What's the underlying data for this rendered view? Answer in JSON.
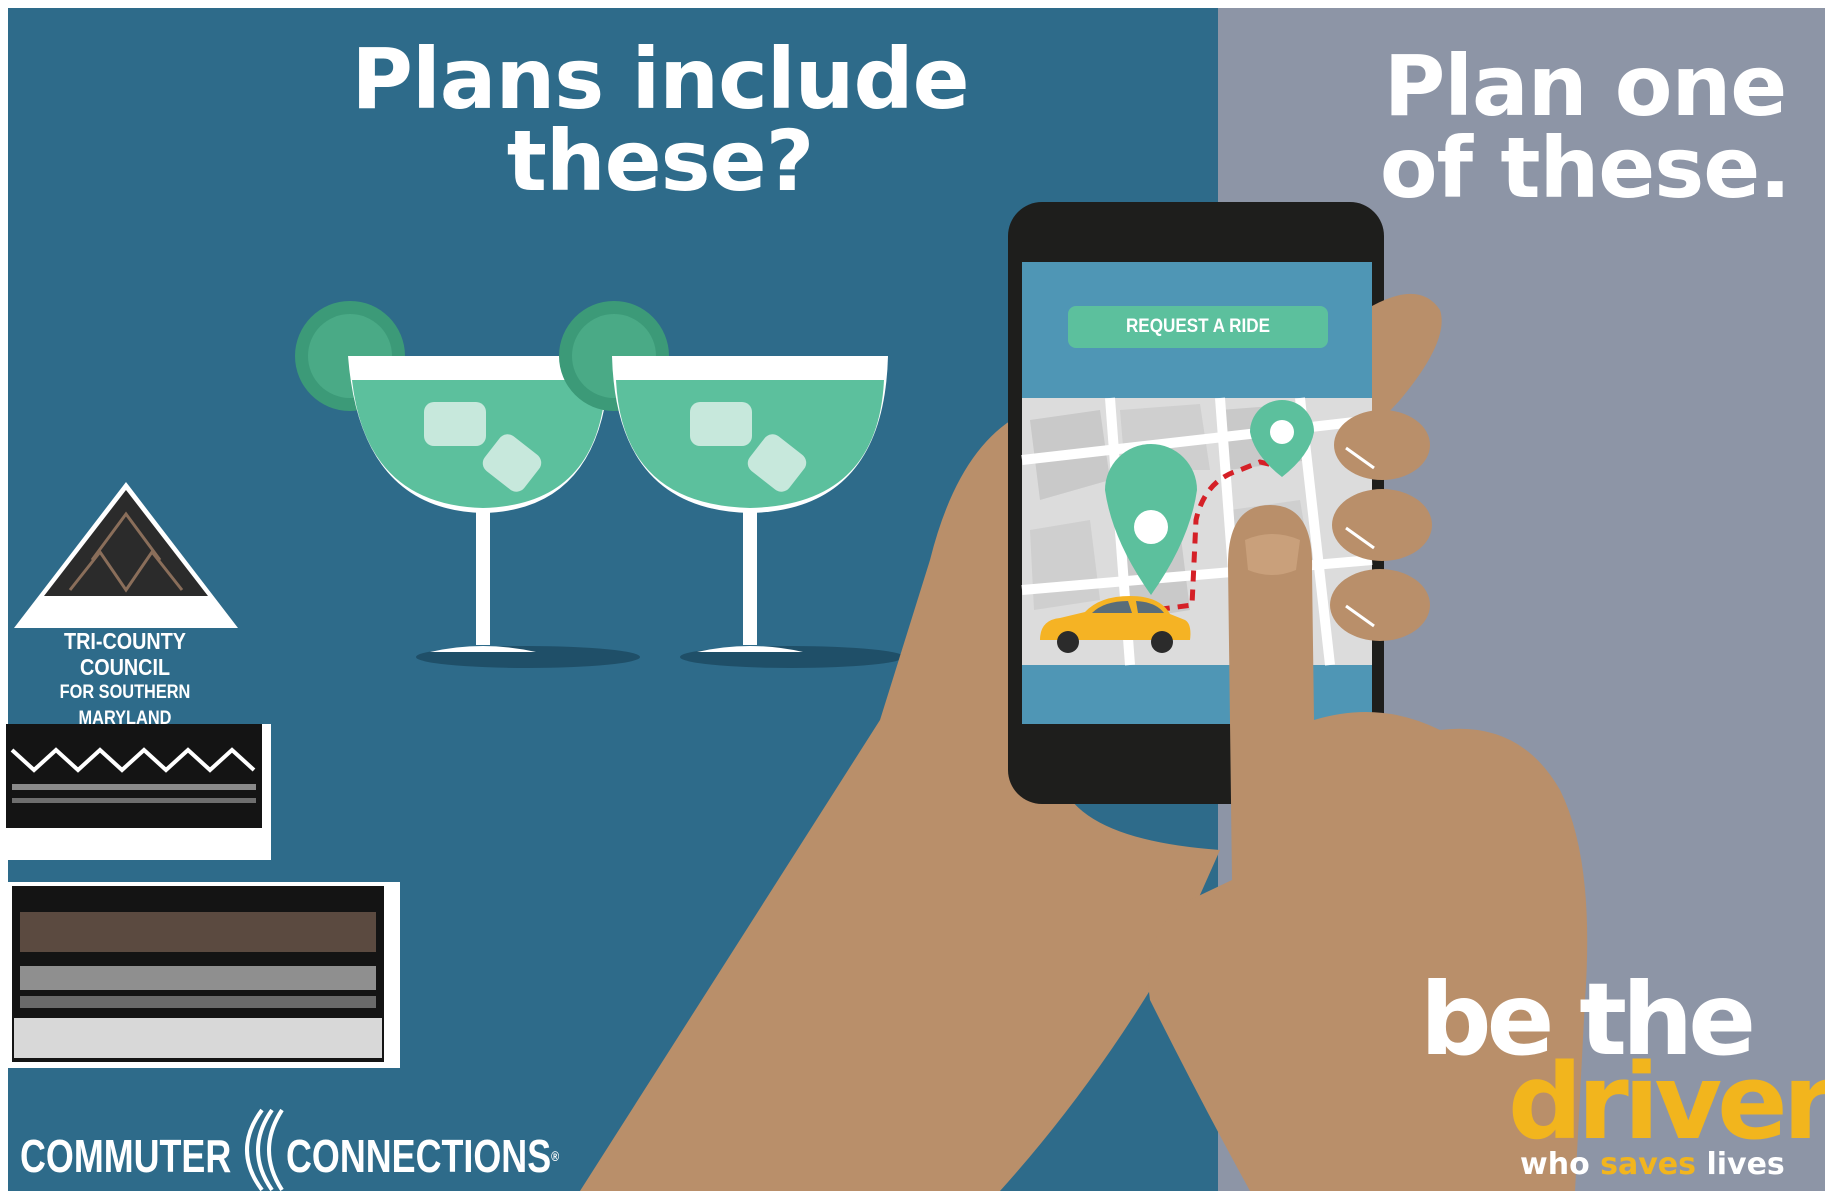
{
  "headline_left": {
    "line1": "Plans include",
    "line2": "these?"
  },
  "headline_right": {
    "line1": "Plan one",
    "line2": "of these."
  },
  "phone": {
    "button_label": "REQUEST A RIDE"
  },
  "logos": {
    "tri_county": {
      "line1": "TRI-COUNTY COUNCIL",
      "line2": "FOR SOUTHERN MARYLAND"
    },
    "commuter": {
      "word1": "COMMUTER",
      "word2": "CONNECTIONS",
      "mark": "®"
    }
  },
  "campaign": {
    "word1": "be the",
    "word2": "driver",
    "tagline_start": "who ",
    "tagline_accent": "saves",
    "tagline_end": " lives"
  },
  "colors": {
    "panel_left": "#2e6b8a",
    "panel_right": "#8d95a6",
    "accent_green": "#5cc09d",
    "skin": "#b98f6a",
    "campaign_yellow": "#f2b51d",
    "taxi": "#f5b324"
  }
}
